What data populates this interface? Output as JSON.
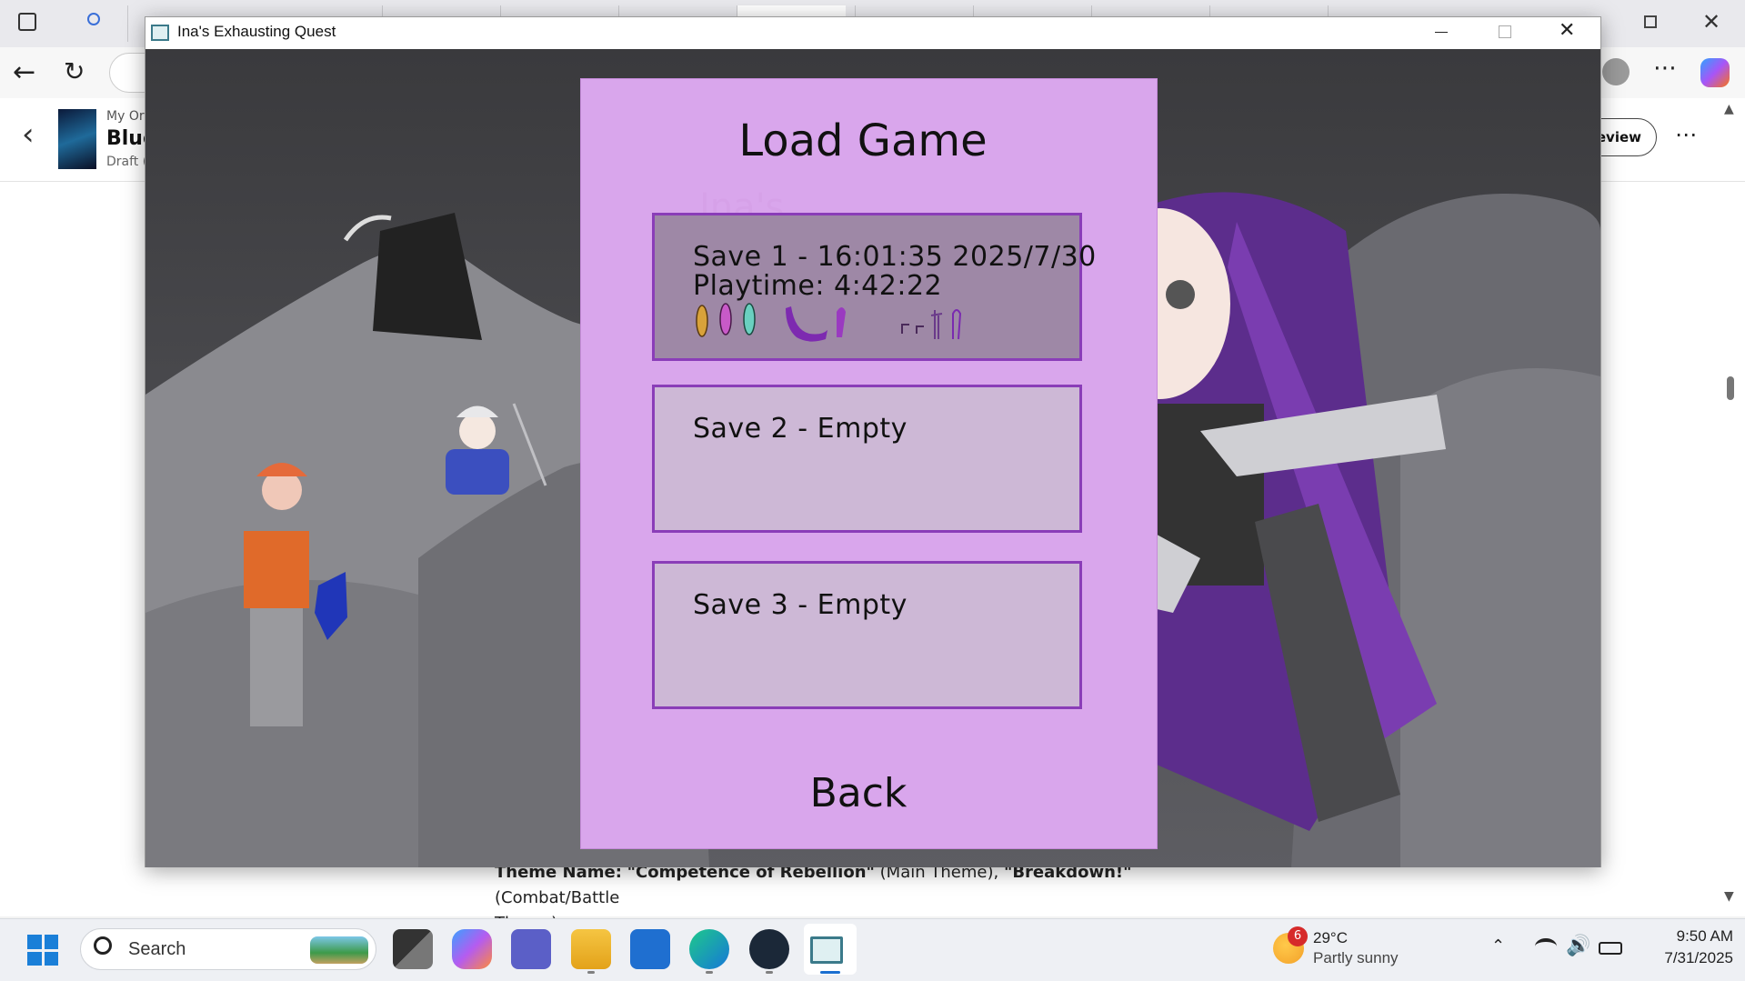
{
  "window": {
    "title": "Ina's Exhausting Quest"
  },
  "browser": {
    "doc_breadcrumb": "My Ori",
    "doc_title": "Blue",
    "doc_status": "Draft (",
    "preview_label": "review",
    "more_label": "⋯"
  },
  "doc_text": {
    "theme_label": "Theme Name:",
    "theme_value": "\"Competence of Rebellion\"",
    "main_theme": "(Main Theme),",
    "breakdown": "\"Breakdown!\"",
    "combat_theme": "(Combat/Battle",
    "theme_end": "Theme)"
  },
  "load_menu": {
    "title": "Load Game",
    "faint_logo": "Ina's",
    "slots": [
      {
        "line1": "Save 1 - 16:01:35 2025/7/30",
        "line2": "Playtime:  4:42:22",
        "has_items": true
      },
      {
        "line1": "Save 2 - Empty",
        "line2": "",
        "has_items": false
      },
      {
        "line1": "Save 3 - Empty",
        "line2": "",
        "has_items": false
      }
    ],
    "back_label": "Back"
  },
  "taskbar": {
    "search_placeholder": "Search",
    "weather_temp": "29°C",
    "weather_desc": "Partly sunny",
    "weather_badge": "6",
    "time": "9:50 AM",
    "date": "7/31/2025"
  },
  "colors": {
    "panel": "#d9a6ec",
    "slot_border": "#8a3db8",
    "slot_filled": "#9e88a6",
    "slot_empty": "#cdb8d6"
  }
}
